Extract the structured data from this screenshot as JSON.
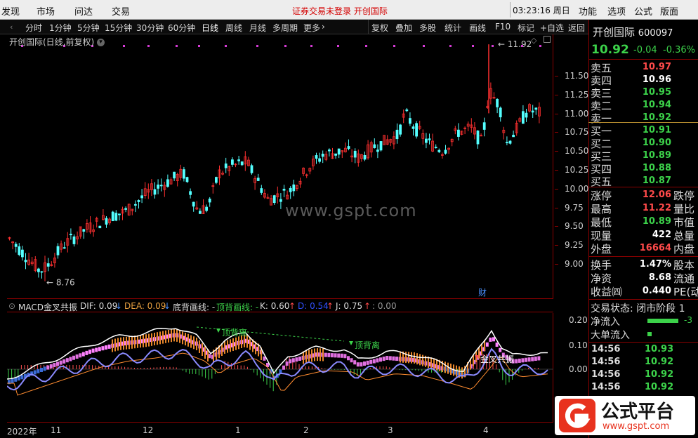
{
  "menu": {
    "items": [
      "发现",
      "市场",
      "问达",
      "交易"
    ],
    "notice": "证券交易未登录",
    "notice_stock": "开创国际",
    "time": "03:23:16 周日",
    "right": [
      "功能",
      "选项",
      "公式",
      "版面"
    ]
  },
  "periods": [
    "分时",
    "1分钟",
    "5分钟",
    "15分钟",
    "30分钟",
    "60分钟",
    "日线",
    "周线",
    "月线",
    "多周期",
    "更多"
  ],
  "active_period": "日线",
  "tools": [
    "复权",
    "叠加",
    "多股",
    "统计",
    "画线",
    "F10",
    "标记",
    "+自选",
    "返回"
  ],
  "chart": {
    "title": "开创国际(日线,前复权)",
    "watermark": "www.gspt.com",
    "high_label": "11.92",
    "low_label": "8.76",
    "cai_label": "财",
    "price_ticks": [
      "11.50",
      "11.25",
      "11.00",
      "10.75",
      "10.50",
      "10.25",
      "10.00",
      "9.75",
      "9.50",
      "9.25",
      "9.00"
    ]
  },
  "indicator": {
    "name": "MACD金叉共振",
    "dif_label": "DIF: 0.09",
    "dea_label": "DEA: 0.09",
    "bottom_div": "底背画线: -",
    "top_div": "顶背画线: -",
    "k_label": "K: 0.60",
    "d_label": "D: 0.54",
    "j_label": "J: 0.75",
    "zero_label": ": 0.00",
    "ticks": [
      "0.20",
      "0.10",
      "0.00"
    ],
    "annotations": [
      "顶背离",
      "顶背离",
      "金叉共振"
    ]
  },
  "time_axis": [
    "2022年",
    "11",
    "12",
    "1",
    "2",
    "3",
    "4"
  ],
  "quote": {
    "name": "开创国际",
    "code": "600097",
    "price": "10.92",
    "change": "-0.04",
    "pct": "-0.36%",
    "sell": [
      {
        "label": "卖五",
        "price": "10.97",
        "color": "#ff4a4a"
      },
      {
        "label": "卖四",
        "price": "10.96",
        "color": "#ffffff"
      },
      {
        "label": "卖三",
        "price": "10.95",
        "color": "#3cd24a"
      },
      {
        "label": "卖二",
        "price": "10.94",
        "color": "#3cd24a"
      },
      {
        "label": "卖一",
        "price": "10.92",
        "color": "#3cd24a"
      }
    ],
    "buy": [
      {
        "label": "买一",
        "price": "10.91",
        "color": "#3cd24a"
      },
      {
        "label": "买二",
        "price": "10.90",
        "color": "#3cd24a"
      },
      {
        "label": "买三",
        "price": "10.89",
        "color": "#3cd24a"
      },
      {
        "label": "买四",
        "price": "10.88",
        "color": "#3cd24a"
      },
      {
        "label": "买五",
        "price": "10.87",
        "color": "#3cd24a"
      }
    ],
    "stats": [
      {
        "label": "涨停",
        "value": "12.06",
        "color": "#ff4a4a",
        "label2": "跌停"
      },
      {
        "label": "最高",
        "value": "11.22",
        "color": "#ff4a4a",
        "label2": "量比"
      },
      {
        "label": "最低",
        "value": "10.89",
        "color": "#3cd24a",
        "label2": "市值"
      },
      {
        "label": "现量",
        "value": "422",
        "color": "#ffffff",
        "label2": "总量"
      },
      {
        "label": "外盘",
        "value": "16664",
        "color": "#ff4a4a",
        "label2": "内盘"
      },
      {
        "label": "换手",
        "value": "1.47%",
        "color": "#ffffff",
        "label2": "股本"
      },
      {
        "label": "净资",
        "value": "8.68",
        "color": "#ffffff",
        "label2": "流通"
      },
      {
        "label": "收益㈣",
        "value": "0.440",
        "color": "#ffffff",
        "label2": "PE(动"
      }
    ],
    "trade_status": "交易状态: 闭市阶段 1",
    "net_inflow": "净流入",
    "net_inflow_val": "-3",
    "big_inflow": "大单流入",
    "trades": [
      {
        "time": "14:56",
        "price": "10.93"
      },
      {
        "time": "14:56",
        "price": "10.92"
      },
      {
        "time": "14:56",
        "price": "10.92"
      },
      {
        "time": "14:56",
        "price": "10.92"
      }
    ]
  },
  "logo": {
    "main": "公式平台",
    "sub": "www.gspt.com"
  }
}
